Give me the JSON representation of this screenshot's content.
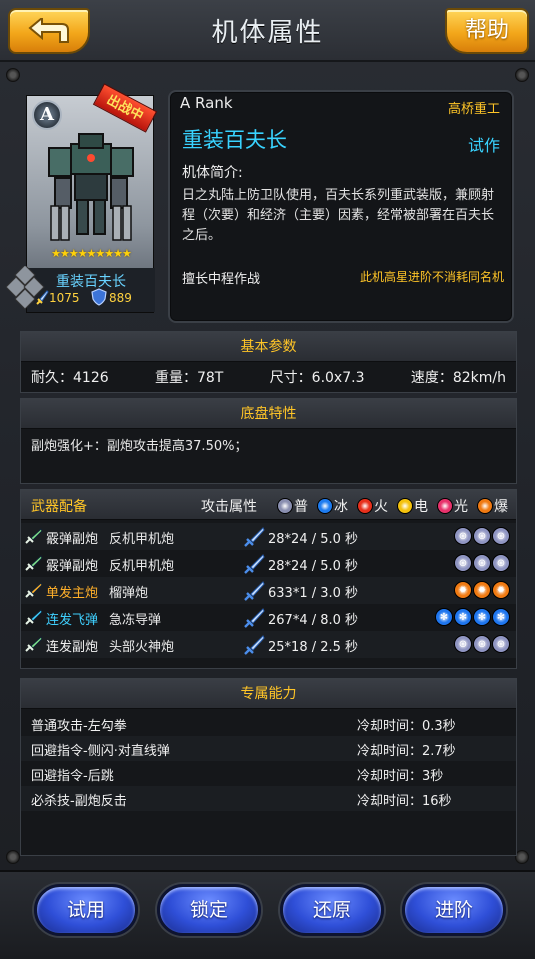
{
  "header": {
    "title": "机体属性",
    "help_label": "帮助"
  },
  "mech_card": {
    "rank_letter": "A",
    "deployed_tag": "出战中",
    "stars": "★★★★★★★★★",
    "name": "重装百夫长",
    "attack": "1075",
    "defense": "889"
  },
  "info": {
    "rank": "A  Rank",
    "maker": "高桥重工",
    "name": "重装百夫长",
    "trial": "试作",
    "intro_label": "机体简介:",
    "intro_text": "日之丸陆上防卫队使用，百夫长系列重武装版，兼顾射程（次要）和经济（主要）因素，经常被部署在百夫长之后。",
    "skill": "擅长中程作战",
    "skill_note": "此机高星进阶不消耗同名机"
  },
  "basic_params": {
    "title": "基本参数",
    "durability": "耐久：4126",
    "weight": "重量：78T",
    "size": "尺寸：6.0x7.3",
    "speed": "速度：82km/h"
  },
  "chassis": {
    "title": "底盘特性",
    "text": "副炮强化+：副炮攻击提高37.50%；"
  },
  "weapons": {
    "title": "武器配备",
    "attr_label": "攻击属性",
    "elements": [
      {
        "label": "普",
        "color": "#8a8fb0"
      },
      {
        "label": "冰",
        "color": "#1e7cf0"
      },
      {
        "label": "火",
        "color": "#e8301c"
      },
      {
        "label": "电",
        "color": "#f4c20d"
      },
      {
        "label": "光",
        "color": "#e8326c"
      },
      {
        "label": "爆",
        "color": "#f07a12"
      }
    ],
    "rows": [
      {
        "type": "霰弹副炮",
        "type_color": "#f0f0f0",
        "name": "反机甲机炮",
        "dmg": "28*24 / 5.0 秒",
        "orbs": [
          "normal",
          "normal",
          "normal"
        ]
      },
      {
        "type": "霰弹副炮",
        "type_color": "#f0f0f0",
        "name": "反机甲机炮",
        "dmg": "28*24 / 5.0 秒",
        "orbs": [
          "normal",
          "normal",
          "normal"
        ]
      },
      {
        "type": "单发主炮",
        "type_color": "#ffb02a",
        "name": "榴弹炮",
        "dmg": "633*1 / 3.0 秒",
        "orbs": [
          "burst",
          "burst",
          "burst"
        ]
      },
      {
        "type": "连发飞弹",
        "type_color": "#3fd0ff",
        "name": "急冻导弹",
        "dmg": "267*4 / 8.0 秒",
        "orbs": [
          "ice",
          "ice",
          "ice",
          "ice"
        ]
      },
      {
        "type": "连发副炮",
        "type_color": "#f0f0f0",
        "name": "头部火神炮",
        "dmg": "25*18 / 2.5 秒",
        "orbs": [
          "normal",
          "normal",
          "normal"
        ]
      }
    ]
  },
  "abilities": {
    "title": "专属能力",
    "rows": [
      {
        "name": "普通攻击-左勾拳",
        "cd": "冷却时间：0.3秒"
      },
      {
        "name": "回避指令-侧闪·对直线弹",
        "cd": "冷却时间：2.7秒"
      },
      {
        "name": "回避指令-后跳",
        "cd": "冷却时间：3秒"
      },
      {
        "name": "必杀技-副炮反击",
        "cd": "冷却时间：16秒"
      }
    ]
  },
  "buttons": {
    "trial": "试用",
    "lock": "锁定",
    "restore": "还原",
    "advance": "进阶"
  }
}
